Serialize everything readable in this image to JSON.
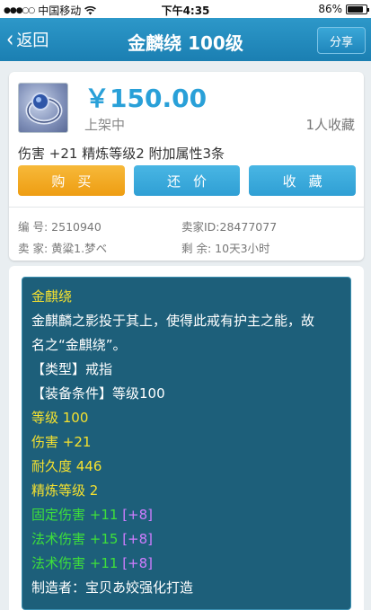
{
  "status_bar": {
    "signal": "●●●○○",
    "carrier": "中国移动",
    "time": "下午4:35",
    "battery_text": "86%",
    "battery_level": 0.86
  },
  "nav": {
    "back_label": "返回",
    "title": "金麟绕 100级",
    "share_label": "分享"
  },
  "item": {
    "price": "￥150.00",
    "status": "上架中",
    "favorites": "1人收藏",
    "attributes": "伤害 +21  精炼等级2  附加属性3条",
    "buttons": {
      "buy": "购买",
      "bargain": "还价",
      "favorite": "收藏"
    },
    "meta": {
      "serial_label": "编  号:",
      "serial_value": "2510940",
      "seller_id_label": "卖家ID:",
      "seller_id_value": "28477077",
      "seller_label": "卖  家:",
      "seller_value": "黄粱1.梦ベ",
      "remaining_label": "剩  余:",
      "remaining_value": "10天3小时"
    }
  },
  "description": {
    "name": "金麒绕",
    "lore": [
      "金麒麟之影投于其上，使得此戒有护主之能，故",
      "名之“金麒绕”。"
    ],
    "type": "【类型】戒指",
    "requirement": "【装备条件】等级100",
    "level": "等级 100",
    "damage": "伤害 +21",
    "durability": "耐久度 446",
    "refine": "精炼等级 2",
    "bonuses": [
      {
        "text": "固定伤害 +11 ",
        "extra": "[+8]"
      },
      {
        "text": "法术伤害 +15 ",
        "extra": "[+8]"
      },
      {
        "text": "法术伤害 +11 ",
        "extra": "[+8]"
      }
    ],
    "maker": "制造者：宝贝あ姣强化打造"
  }
}
